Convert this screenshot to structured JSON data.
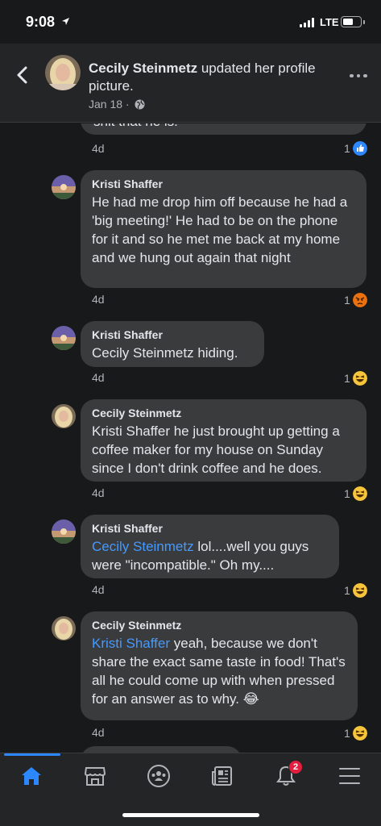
{
  "status_bar": {
    "time": "9:08",
    "network": "LTE"
  },
  "header": {
    "author": "Cecily Steinmetz",
    "action": "updated her profile picture.",
    "date": "Jan 18 ·"
  },
  "cut_comment": {
    "text": "shit that he is!",
    "time": "4d",
    "reaction_count": "1",
    "reaction_type": "like"
  },
  "comments": [
    {
      "author": "Kristi Shaffer",
      "mention": "",
      "text": "He had me drop him off because he had a 'big meeting!' He had to be on the phone for it and so he met me back at my home and we hung out again that night",
      "time": "4d",
      "reaction_count": "1",
      "reaction_type": "angry"
    },
    {
      "author": "Kristi Shaffer",
      "mention": "",
      "text": "Cecily Steinmetz hiding.",
      "time": "4d",
      "reaction_count": "1",
      "reaction_type": "haha"
    },
    {
      "author": "Cecily Steinmetz",
      "mention": "",
      "text": "Kristi Shaffer he just brought up getting a coffee maker for my house on Sunday since I don't drink coffee and he does.",
      "time": "4d",
      "reaction_count": "1",
      "reaction_type": "haha"
    },
    {
      "author": "Kristi Shaffer",
      "mention": "Cecily Steinmetz",
      "text": " lol....well you guys were \"incompatible.\" Oh my....",
      "time": "4d",
      "reaction_count": "1",
      "reaction_type": "haha"
    },
    {
      "author": "Cecily Steinmetz",
      "mention": "Kristi Shaffer",
      "text": " yeah, because we don't share the exact same taste in food! That's all he could come up with when pressed for an answer as to why. 😂",
      "time": "4d",
      "reaction_count": "1",
      "reaction_type": "haha"
    }
  ],
  "tabbar": {
    "items": [
      "home",
      "marketplace",
      "groups",
      "news",
      "notifications",
      "menu"
    ],
    "active": "home",
    "notification_badge": "2"
  },
  "colors": {
    "accent": "#2d88ff",
    "mention": "#4599ff",
    "bubble": "#3a3b3c",
    "background": "#18191a"
  }
}
